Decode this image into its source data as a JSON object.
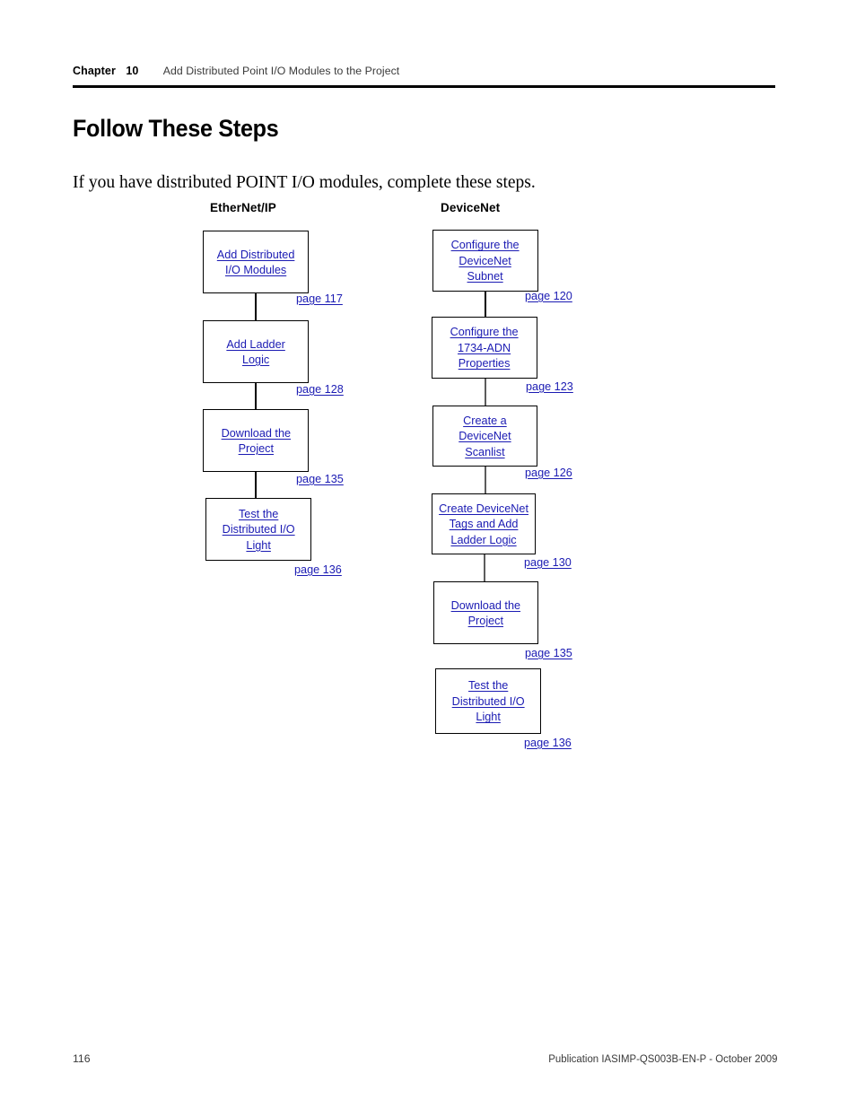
{
  "header": {
    "chapter_word": "Chapter",
    "chapter_number": "10",
    "chapter_title": "Add Distributed Point I/O Modules to the Project"
  },
  "page": {
    "title": "Follow These Steps",
    "intro": "If you have distributed POINT I/O modules, complete these steps."
  },
  "colors": {
    "link": "#1b1bb3",
    "text": "#000000",
    "muted": "#3a3a3a",
    "connector": "#000000",
    "connector_gray": "#5c5c5c"
  },
  "flow": {
    "columns": [
      {
        "heading": "EtherNet/IP",
        "steps": [
          {
            "label": "Add Distributed\nI/O Modules",
            "page_ref": "page 117"
          },
          {
            "label": "Add Ladder\nLogic",
            "page_ref": "page 128"
          },
          {
            "label": "Download the\nProject",
            "page_ref": "page 135"
          },
          {
            "label": "Test the\nDistributed I/O\nLight",
            "page_ref": "page 136"
          }
        ]
      },
      {
        "heading": "DeviceNet",
        "steps": [
          {
            "label": "Configure the\nDeviceNet\nSubnet",
            "page_ref": "page 120"
          },
          {
            "label": "Configure the\n1734-ADN\nProperties",
            "page_ref": "page 123"
          },
          {
            "label": "Create a\nDeviceNet\nScanlist",
            "page_ref": "page 126"
          },
          {
            "label": "Create DeviceNet\nTags and Add\nLadder Logic",
            "page_ref": "page 130"
          },
          {
            "label": "Download the\nProject",
            "page_ref": "page 135"
          },
          {
            "label": "Test the\nDistributed I/O\nLight",
            "page_ref": "page 136"
          }
        ]
      }
    ]
  },
  "footer": {
    "page_number": "116",
    "publication": "Publication IASIMP-QS003B-EN-P - October 2009"
  }
}
